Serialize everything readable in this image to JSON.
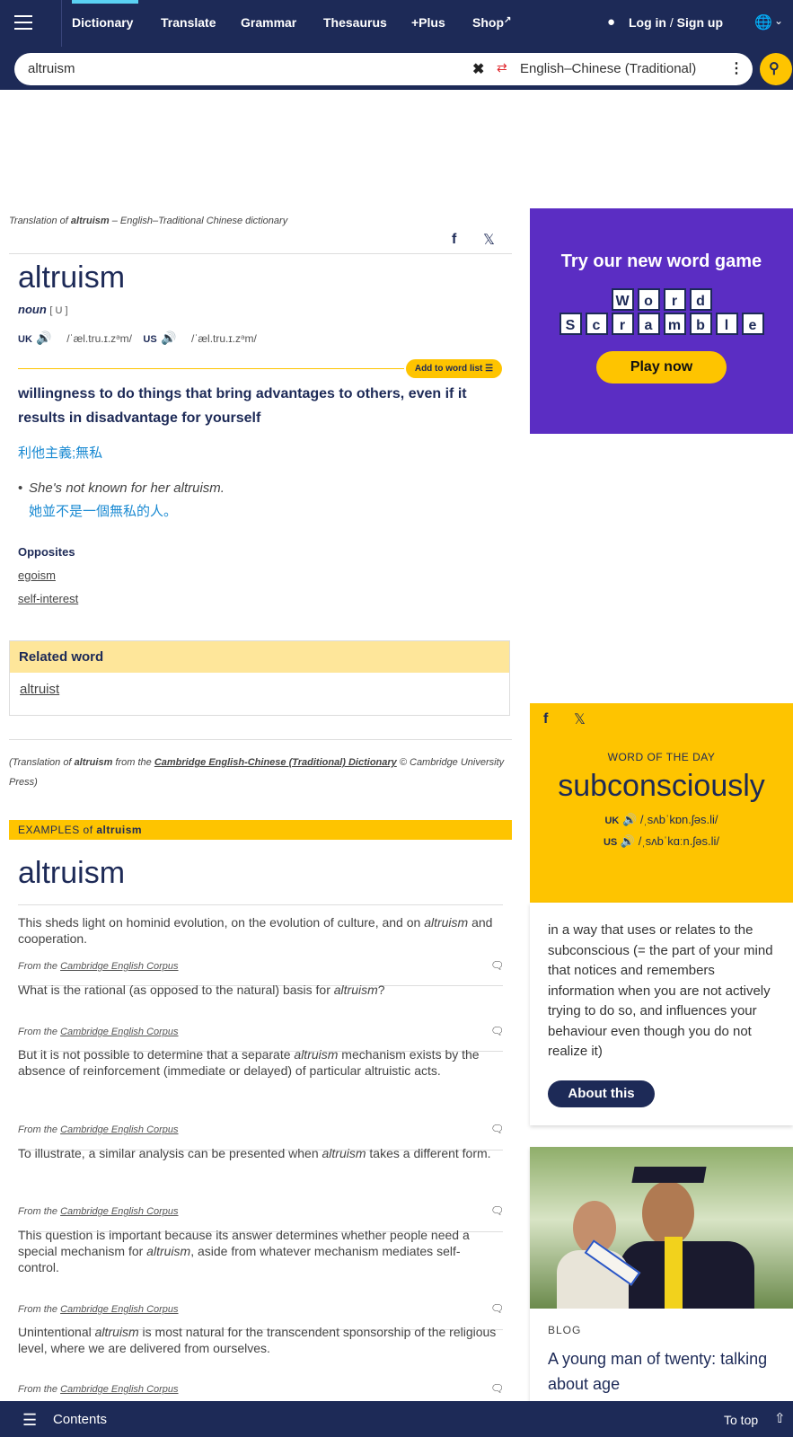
{
  "nav": {
    "items": [
      "Dictionary",
      "Translate",
      "Grammar",
      "Thesaurus",
      "+Plus",
      "Shop"
    ],
    "login": "Log in",
    "signup": "Sign up",
    "sep": "/"
  },
  "search": {
    "value": "altruism",
    "language": "English–Chinese (Traditional)"
  },
  "entry": {
    "source_prefix": "Translation of ",
    "source_word": "altruism",
    "source_suffix": " – English–Traditional Chinese dictionary",
    "headword": "altruism",
    "pos": "noun",
    "grammar": "[ U ]",
    "uk_label": "UK",
    "uk_ipa": "/ˈæl.tru.ɪ.zᵊm/",
    "us_label": "US",
    "us_ipa": "/ˈæl.tru.ɪ.zᵊm/",
    "add_to_list": "Add to word list",
    "definition": "willingness to do things that bring advantages to others, even if it results in disadvantage for yourself",
    "translation": "利他主義;無私",
    "example_en": "She's not known for her altruism.",
    "example_zh": "她並不是一個無私的人。",
    "opposites_title": "Opposites",
    "opposites": [
      "egoism",
      "self-interest"
    ],
    "related_title": "Related word",
    "related": "altruist",
    "credit_prefix": "(Translation of ",
    "credit_word": "altruism",
    "credit_mid": " from the ",
    "credit_link": "Cambridge English-Chinese (Traditional) Dictionary",
    "credit_suffix": " © Cambridge University Press)"
  },
  "examples": {
    "header_prefix": "EXAMPLES of ",
    "header_word": "altruism",
    "title": "altruism",
    "from_prefix": "From the ",
    "from_link": "Cambridge English Corpus",
    "items": [
      {
        "before": "This sheds light on hominid evolution, on the evolution of culture, and on ",
        "word": "altruism",
        "after": " and cooperation."
      },
      {
        "before": "What is the rational (as opposed to the natural) basis for ",
        "word": "altruism",
        "after": "?"
      },
      {
        "before": "But it is not possible to determine that a separate ",
        "word": "altruism",
        "after": " mechanism exists by the absence of reinforcement (immediate or delayed) of particular altruistic acts."
      },
      {
        "before": "To illustrate, a similar analysis can be presented when ",
        "word": "altruism",
        "after": " takes a different form."
      },
      {
        "before": "This question is important because its answer determines whether people need a special mechanism for ",
        "word": "altruism",
        "after": ", aside from whatever mechanism mediates self-control."
      },
      {
        "before": "Unintentional ",
        "word": "altruism",
        "after": " is most natural for the transcendent sponsorship of the religious level, where we are delivered from ourselves."
      }
    ]
  },
  "game_ad": {
    "title": "Try our new word game",
    "row1": [
      "W",
      "o",
      "r",
      "d"
    ],
    "row2": [
      "S",
      "c",
      "r",
      "a",
      "m",
      "b",
      "l",
      "e"
    ],
    "button": "Play now"
  },
  "wotd": {
    "label": "WORD OF THE DAY",
    "word": "subconsciously",
    "uk_label": "UK",
    "uk_ipa": "/ˌsʌbˈkɒn.ʃəs.li/",
    "us_label": "US",
    "us_ipa": "/ˌsʌbˈkɑːn.ʃəs.li/",
    "definition": "in a way that uses or relates to the subconscious (= the part of your mind that notices and remembers information when you are not actively trying to do so, and influences your behaviour even though you do not realize it)",
    "button": "About this"
  },
  "blog": {
    "label": "BLOG",
    "title": "A young man of twenty: talking about age"
  },
  "bottom": {
    "contents": "Contents",
    "to_top": "To top"
  },
  "colors": {
    "navy": "#1d2a57",
    "yellow": "#fec400",
    "purple": "#5b2dc3",
    "link_blue": "#1a8ad2",
    "light_yellow": "#fee69a"
  }
}
